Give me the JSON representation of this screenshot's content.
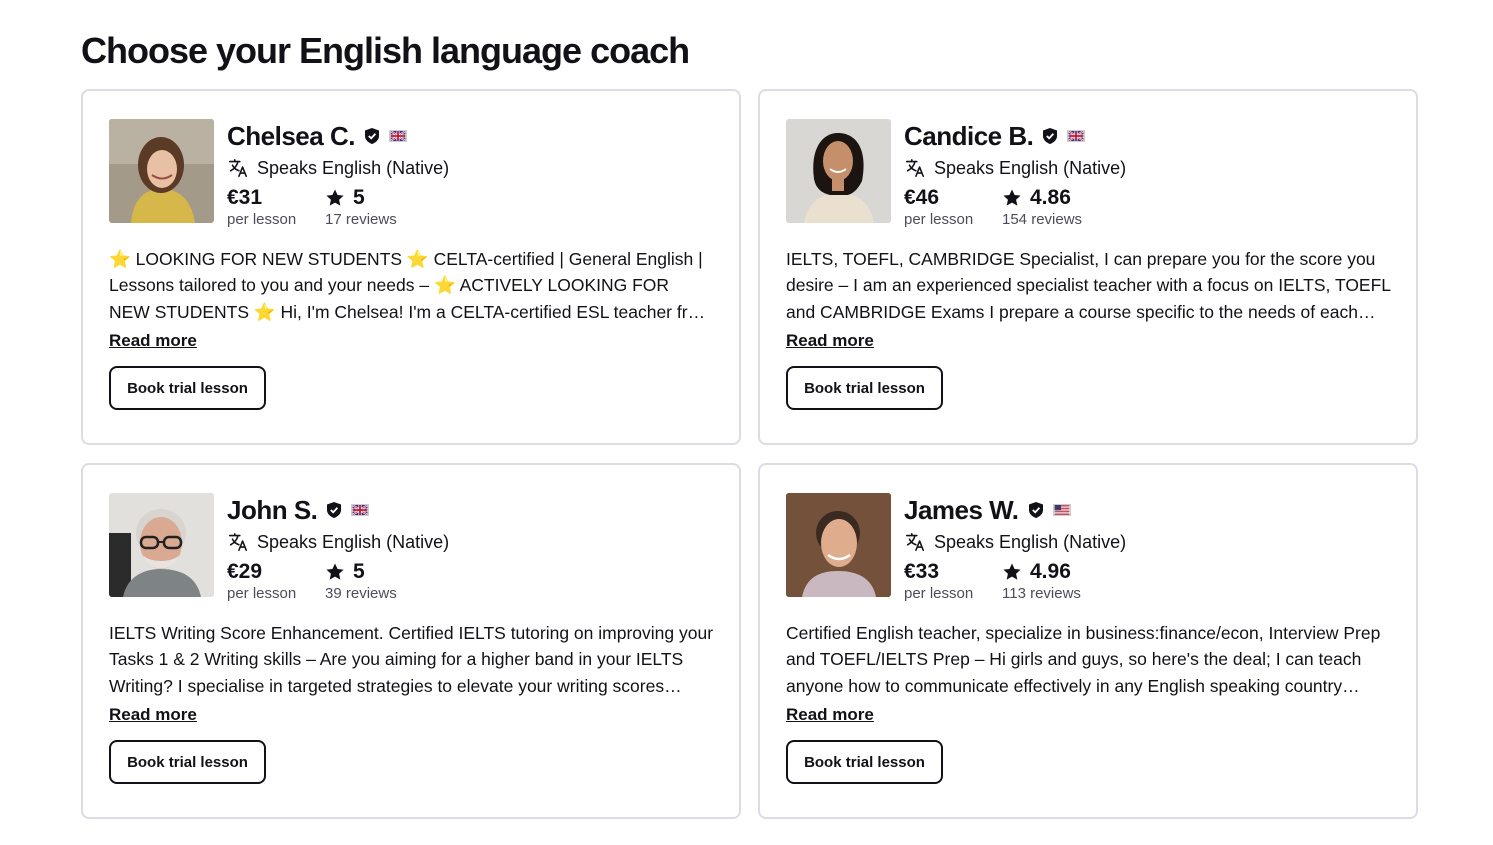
{
  "page": {
    "title": "Choose your English language coach"
  },
  "colors": {
    "text": "#121117",
    "muted": "#4d4c5c",
    "card_border": "#dcdce5",
    "star_fill": "#ffd43b"
  },
  "tutors": [
    {
      "name": "Chelsea C.",
      "flag": "uk-flag-icon",
      "speaks": "Speaks English (Native)",
      "price": "€31",
      "price_label": "per lesson",
      "rating": "5",
      "reviews": "17 reviews",
      "description": "⭐ LOOKING FOR NEW STUDENTS ⭐ CELTA-certified | General English | Lessons tailored to you and your needs – ⭐ ACTIVELY LOOKING FOR NEW STUDENTS ⭐ Hi, I'm Chelsea! I'm a CELTA-certified ESL teacher from the UK with experience teaching students of all levels.",
      "read_more": "Read more",
      "button": "Book trial lesson"
    },
    {
      "name": "Candice B.",
      "flag": "uk-flag-icon",
      "speaks": "Speaks English (Native)",
      "price": "€46",
      "price_label": "per lesson",
      "rating": "4.86",
      "reviews": "154 reviews",
      "description": "IELTS, TOEFL, CAMBRIDGE Specialist, I can prepare you for the score you desire – I am an experienced specialist teacher with a focus on IELTS, TOEFL and CAMBRIDGE Exams I prepare a course specific to the needs of each student.",
      "read_more": "Read more",
      "button": "Book trial lesson"
    },
    {
      "name": "John S.",
      "flag": "uk-flag-icon",
      "speaks": "Speaks English (Native)",
      "price": "€29",
      "price_label": "per lesson",
      "rating": "5",
      "reviews": "39 reviews",
      "description": "IELTS Writing Score Enhancement. Certified IELTS tutoring on improving your Tasks 1 & 2 Writing skills – Are you aiming for a higher band in your IELTS Writing? I specialise in targeted strategies to elevate your writing scores quickly.",
      "read_more": "Read more",
      "button": "Book trial lesson"
    },
    {
      "name": "James W.",
      "flag": "us-flag-icon",
      "speaks": "Speaks English (Native)",
      "price": "€33",
      "price_label": "per lesson",
      "rating": "4.96",
      "reviews": "113 reviews",
      "description": "Certified English teacher, specialize in business:finance/econ, Interview Prep and TOEFL/IELTS Prep – Hi girls and guys, so here's the deal; I can teach anyone how to communicate effectively in any English speaking country quickly.",
      "read_more": "Read more",
      "button": "Book trial lesson"
    }
  ]
}
